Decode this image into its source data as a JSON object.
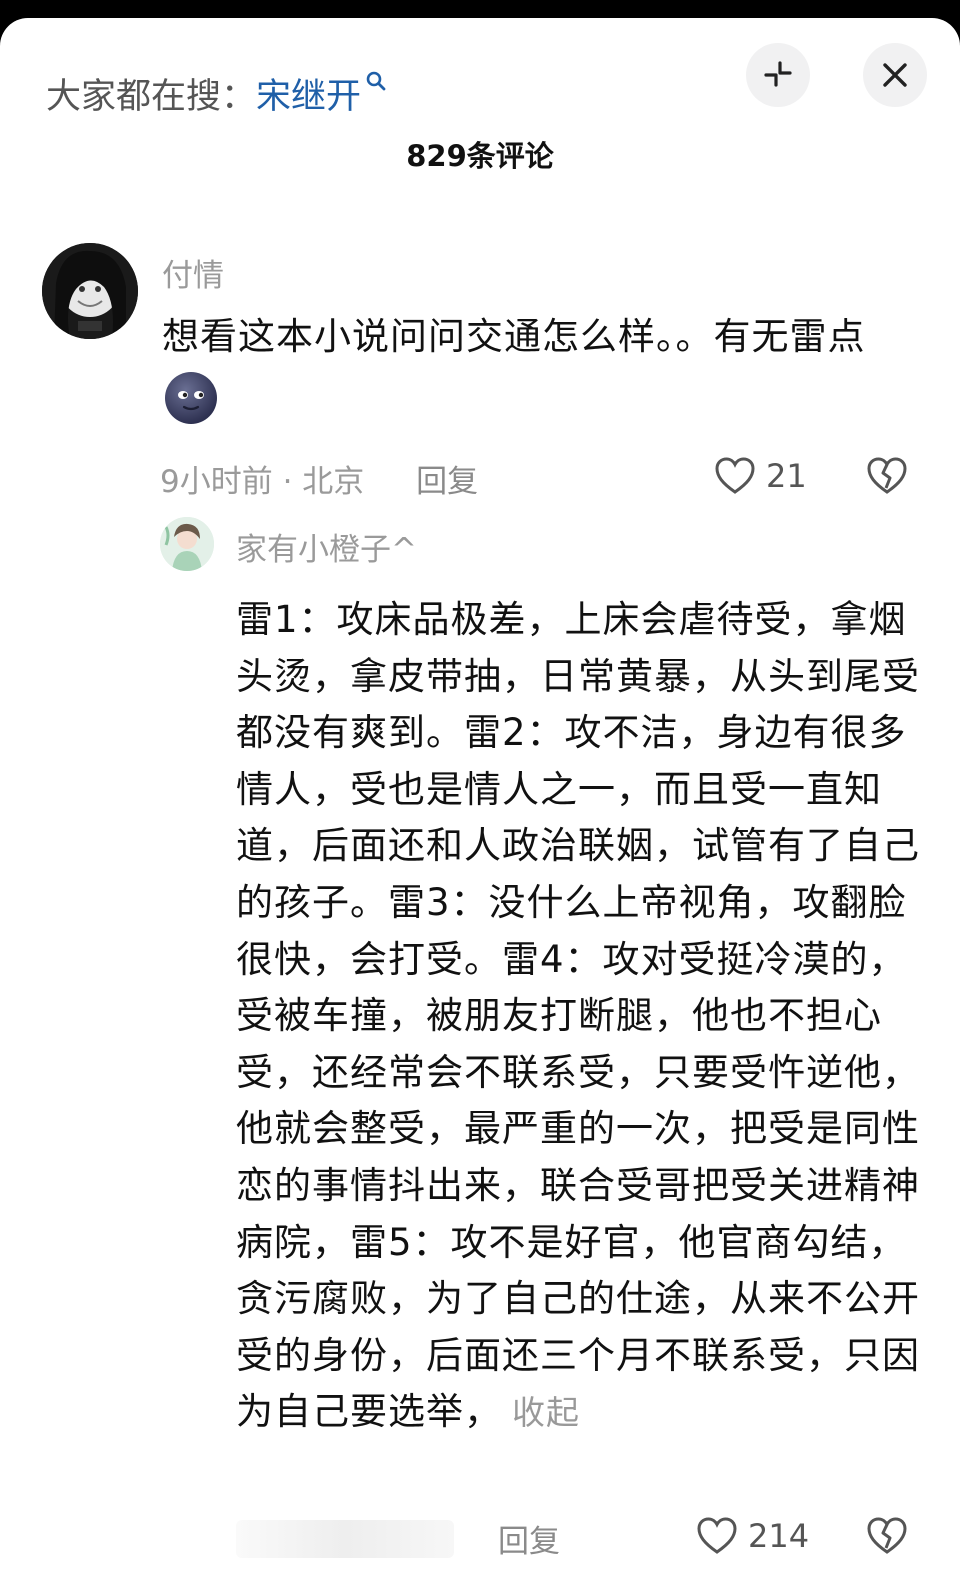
{
  "search": {
    "prefix": "大家都在搜：",
    "term": "宋继开"
  },
  "header": {
    "title": "829条评论"
  },
  "comment": {
    "username": "付情",
    "text": "想看这本小说问问交通怎么样。。有无雷点",
    "time_location": "9小时前 · 北京",
    "reply_label": "回复",
    "likes": "21"
  },
  "reply": {
    "username": "家有小橙子^",
    "text": "雷1：攻床品极差，上床会虐待受，拿烟头烫，拿皮带抽，日常黄暴，从头到尾受都没有爽到。雷2：攻不洁，身边有很多情人，受也是情人之一，而且受一直知道，后面还和人政治联姻，试管有了自己的孩子。雷3：没什么上帝视角，攻翻脸很快，会打受。雷4：攻对受挺冷漠的，受被车撞，被朋友打断腿，他也不担心受，还经常会不联系受，只要受忤逆他，他就会整受，最严重的一次，把受是同性恋的事情抖出来，联合受哥把受关进精神病院，雷5：攻不是好官，他官商勾结，贪污腐败，为了自己的仕途，从来不公开受的身份，后面还三个月不联系受，只因为自己要选举，",
    "collapse_label": "收起",
    "reply_label": "回复",
    "likes": "214"
  }
}
